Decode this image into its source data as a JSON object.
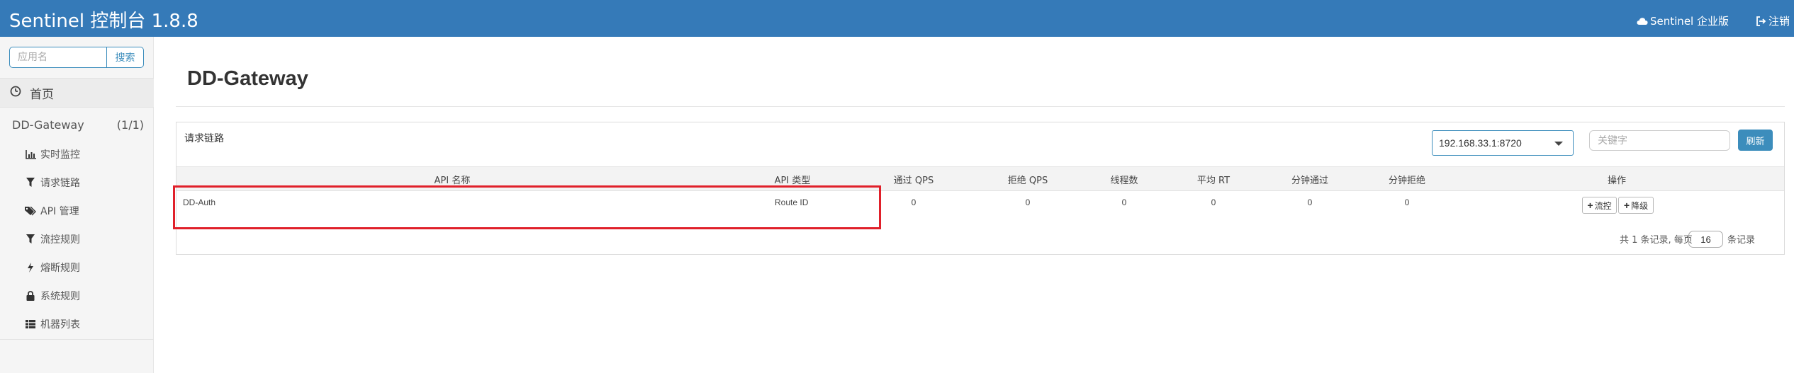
{
  "header": {
    "brand": "Sentinel 控制台 1.8.8",
    "enterprise_link": "Sentinel 企业版",
    "logout_link": "注销"
  },
  "sidebar": {
    "search_placeholder": "应用名",
    "search_button": "搜索",
    "home": "首页",
    "app": {
      "name": "DD-Gateway",
      "count": "(1/1)"
    },
    "menu": [
      {
        "label": "实时监控",
        "icon": "bar-chart-icon"
      },
      {
        "label": "请求链路",
        "icon": "filter-icon"
      },
      {
        "label": "API 管理",
        "icon": "tags-icon"
      },
      {
        "label": "流控规则",
        "icon": "filter-icon"
      },
      {
        "label": "熔断规则",
        "icon": "flash-icon"
      },
      {
        "label": "系统规则",
        "icon": "lock-icon"
      },
      {
        "label": "机器列表",
        "icon": "th-list-icon"
      }
    ]
  },
  "main": {
    "title": "DD-Gateway",
    "panel": {
      "title": "请求链路",
      "machine_select": "192.168.33.1:8720",
      "key_placeholder": "关键字",
      "refresh_button": "刷新",
      "columns": [
        "API 名称",
        "API 类型",
        "通过 QPS",
        "拒绝 QPS",
        "线程数",
        "平均 RT",
        "分钟通过",
        "分钟拒绝",
        "操作"
      ],
      "rows": [
        {
          "api_name": "DD-Auth",
          "api_type": "Route ID",
          "pass_qps": "0",
          "block_qps": "0",
          "threads": "0",
          "avg_rt": "0",
          "min_pass": "0",
          "min_block": "0"
        }
      ],
      "row_actions": {
        "flow": "流控",
        "degrade": "降级"
      },
      "pager": {
        "prefix": "共 1 条记录, 每页",
        "page_size": "16",
        "suffix": "条记录"
      }
    }
  },
  "colors": {
    "header_bg": "#357ab8",
    "accent": "#3c8dbc",
    "highlight": "#e0202a"
  }
}
